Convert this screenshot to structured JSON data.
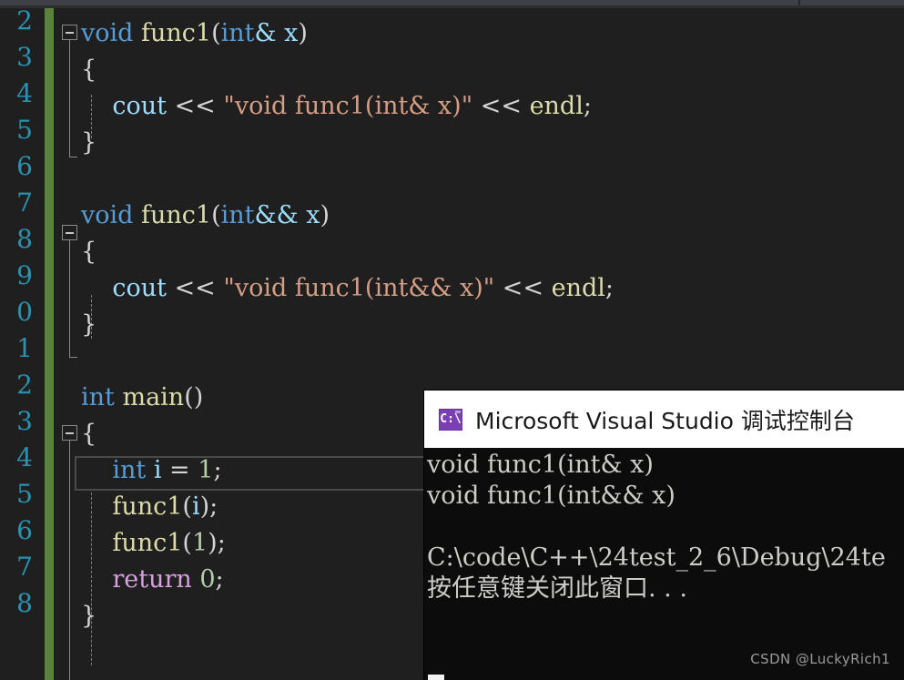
{
  "editor": {
    "background_color": "#1f1f1f",
    "change_bar_color": "#59823b",
    "line_number_color": "#2b91af",
    "line_numbers": [
      "2",
      "3",
      "4",
      "5",
      "6",
      "7",
      "8",
      "9",
      "0",
      "1",
      "2",
      "3",
      "4",
      "5",
      "6",
      "7",
      "8"
    ],
    "lines": [
      {
        "indent": 0,
        "tokens": [
          {
            "t": "void",
            "c": "kw"
          },
          {
            "t": " ",
            "c": "pln"
          },
          {
            "t": "func1",
            "c": "fn"
          },
          {
            "t": "(",
            "c": "pln"
          },
          {
            "t": "int",
            "c": "kw"
          },
          {
            "t": "&",
            "c": "idn"
          },
          {
            "t": " ",
            "c": "pln"
          },
          {
            "t": "x",
            "c": "idn"
          },
          {
            "t": ")",
            "c": "pln"
          }
        ]
      },
      {
        "indent": 0,
        "tokens": [
          {
            "t": "{",
            "c": "pln"
          }
        ]
      },
      {
        "indent": 0,
        "tokens": [
          {
            "t": "    ",
            "c": "pln"
          },
          {
            "t": "cout",
            "c": "idn"
          },
          {
            "t": " ",
            "c": "pln"
          },
          {
            "t": "<<",
            "c": "op"
          },
          {
            "t": " ",
            "c": "pln"
          },
          {
            "t": "\"void func1(int& x)\"",
            "c": "str"
          },
          {
            "t": " ",
            "c": "pln"
          },
          {
            "t": "<<",
            "c": "op"
          },
          {
            "t": " ",
            "c": "pln"
          },
          {
            "t": "endl",
            "c": "fn"
          },
          {
            "t": ";",
            "c": "pln"
          }
        ]
      },
      {
        "indent": 0,
        "tokens": [
          {
            "t": "}",
            "c": "pln"
          }
        ]
      },
      {
        "indent": 0,
        "tokens": [
          {
            "t": "",
            "c": "pln"
          }
        ]
      },
      {
        "indent": 0,
        "tokens": [
          {
            "t": "void",
            "c": "kw"
          },
          {
            "t": " ",
            "c": "pln"
          },
          {
            "t": "func1",
            "c": "fn"
          },
          {
            "t": "(",
            "c": "pln"
          },
          {
            "t": "int",
            "c": "kw"
          },
          {
            "t": "&&",
            "c": "idn"
          },
          {
            "t": " ",
            "c": "pln"
          },
          {
            "t": "x",
            "c": "idn"
          },
          {
            "t": ")",
            "c": "pln"
          }
        ]
      },
      {
        "indent": 0,
        "tokens": [
          {
            "t": "{",
            "c": "pln"
          }
        ]
      },
      {
        "indent": 0,
        "tokens": [
          {
            "t": "    ",
            "c": "pln"
          },
          {
            "t": "cout",
            "c": "idn"
          },
          {
            "t": " ",
            "c": "pln"
          },
          {
            "t": "<<",
            "c": "op"
          },
          {
            "t": " ",
            "c": "pln"
          },
          {
            "t": "\"void func1(int&& x)\"",
            "c": "str"
          },
          {
            "t": " ",
            "c": "pln"
          },
          {
            "t": "<<",
            "c": "op"
          },
          {
            "t": " ",
            "c": "pln"
          },
          {
            "t": "endl",
            "c": "fn"
          },
          {
            "t": ";",
            "c": "pln"
          }
        ]
      },
      {
        "indent": 0,
        "tokens": [
          {
            "t": "}",
            "c": "pln"
          }
        ]
      },
      {
        "indent": 0,
        "tokens": [
          {
            "t": "",
            "c": "pln"
          }
        ]
      },
      {
        "indent": 0,
        "tokens": [
          {
            "t": "int",
            "c": "kw"
          },
          {
            "t": " ",
            "c": "pln"
          },
          {
            "t": "main",
            "c": "fn"
          },
          {
            "t": "()",
            "c": "pln"
          }
        ]
      },
      {
        "indent": 0,
        "tokens": [
          {
            "t": "{",
            "c": "pln"
          }
        ]
      },
      {
        "indent": 0,
        "tokens": [
          {
            "t": "    ",
            "c": "pln"
          },
          {
            "t": "int",
            "c": "kw"
          },
          {
            "t": " ",
            "c": "pln"
          },
          {
            "t": "i",
            "c": "idn"
          },
          {
            "t": " ",
            "c": "pln"
          },
          {
            "t": "=",
            "c": "op"
          },
          {
            "t": " ",
            "c": "pln"
          },
          {
            "t": "1",
            "c": "num"
          },
          {
            "t": ";",
            "c": "pln"
          }
        ]
      },
      {
        "indent": 0,
        "tokens": [
          {
            "t": "    ",
            "c": "pln"
          },
          {
            "t": "func1",
            "c": "fn"
          },
          {
            "t": "(",
            "c": "pln"
          },
          {
            "t": "i",
            "c": "idn"
          },
          {
            "t": ");",
            "c": "pln"
          }
        ]
      },
      {
        "indent": 0,
        "tokens": [
          {
            "t": "    ",
            "c": "pln"
          },
          {
            "t": "func1",
            "c": "fn"
          },
          {
            "t": "(",
            "c": "pln"
          },
          {
            "t": "1",
            "c": "num"
          },
          {
            "t": ");",
            "c": "pln"
          }
        ]
      },
      {
        "indent": 0,
        "tokens": [
          {
            "t": "    ",
            "c": "pln"
          },
          {
            "t": "return",
            "c": "ctl"
          },
          {
            "t": " ",
            "c": "pln"
          },
          {
            "t": "0",
            "c": "num"
          },
          {
            "t": ";",
            "c": "pln"
          }
        ]
      },
      {
        "indent": 0,
        "tokens": [
          {
            "t": "}",
            "c": "pln"
          }
        ]
      }
    ]
  },
  "console": {
    "title": "Microsoft Visual Studio 调试控制台",
    "icon_label": "C:\\",
    "background_color": "#0c0c0c",
    "titlebar_color": "#ffffff",
    "text_color": "#ccccc8",
    "output_lines": [
      "void func1(int& x)",
      "void func1(int&& x)",
      "",
      "C:\\code\\C++\\24test_2_6\\Debug\\24te",
      "按任意键关闭此窗口. . ."
    ]
  },
  "watermark": {
    "text": "CSDN @LuckyRich1"
  }
}
